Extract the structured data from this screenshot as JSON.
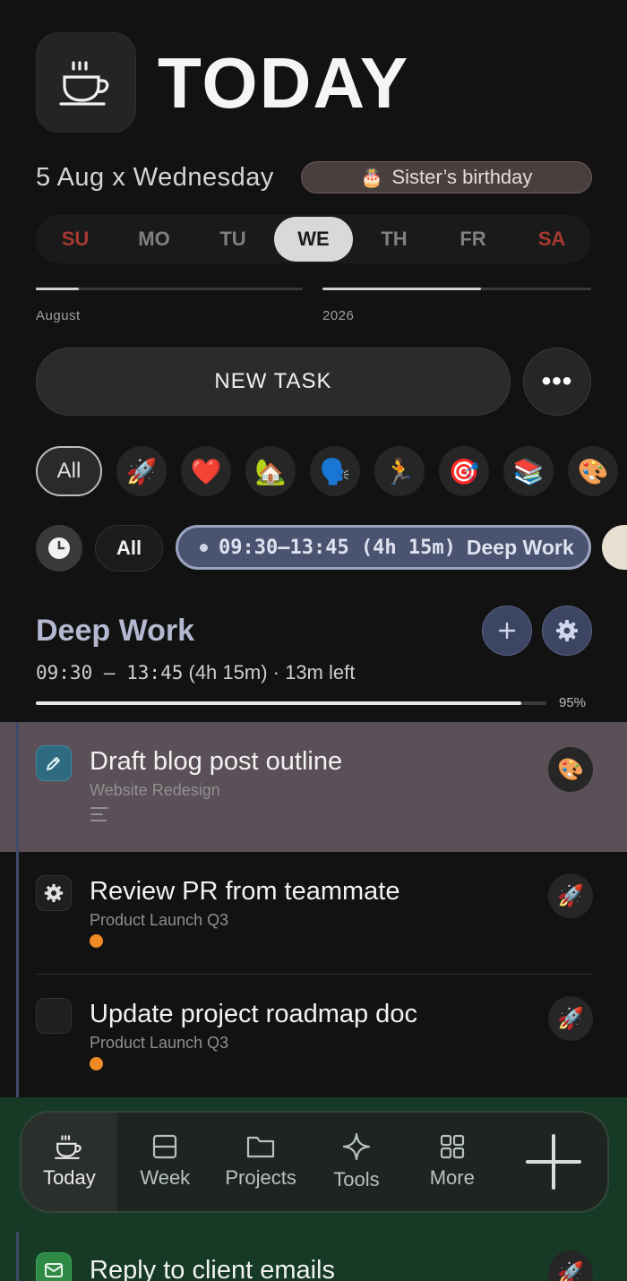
{
  "header": {
    "title": "TODAY",
    "app_icon": "coffee-cup-icon"
  },
  "date": {
    "label": "5 Aug x Wednesday"
  },
  "event": {
    "icon": "🎂",
    "label": "Sister’s birthday"
  },
  "week": {
    "days": [
      "SU",
      "MO",
      "TU",
      "WE",
      "TH",
      "FR",
      "SA"
    ],
    "active_index": 3
  },
  "progress": {
    "month": {
      "label": "August",
      "value": 0.16
    },
    "year": {
      "label": "2026",
      "value": 0.59
    }
  },
  "actions": {
    "new_task_label": "NEW TASK",
    "more_label": "•••"
  },
  "categories": {
    "all_label": "All",
    "items": [
      "🚀",
      "❤️",
      "🏡",
      "🗣️",
      "🏃",
      "🎯",
      "📚",
      "🎨"
    ]
  },
  "time_filter": {
    "all_label": "All",
    "block_time": "09:30–13:45 (4h 15m)",
    "block_name": "Deep Work"
  },
  "block": {
    "title": "Deep Work",
    "time_range": "09:30 — 13:45",
    "duration_left": "(4h 15m) · 13m left",
    "progress_label": "95%",
    "progress_value": 0.95
  },
  "tasks": [
    {
      "title": "Draft blog post outline",
      "project": "Website Redesign",
      "chip": "🎨",
      "check_icon": "pencil-icon",
      "highlighted": true
    },
    {
      "title": "Review PR from teammate",
      "project": "Product Launch Q3",
      "chip": "🚀",
      "check_icon": "gear-icon"
    },
    {
      "title": "Update project roadmap doc",
      "project": "Product Launch Q3",
      "chip": "🚀",
      "check_icon": ""
    },
    {
      "title": "Reply to client emails",
      "project": "",
      "chip": "🚀",
      "check_icon": "envelope-icon"
    }
  ],
  "nav": {
    "items": [
      {
        "label": "Today",
        "icon": "coffee-cup-icon"
      },
      {
        "label": "Week",
        "icon": "calendar-week-icon"
      },
      {
        "label": "Projects",
        "icon": "folder-icon"
      },
      {
        "label": "Tools",
        "icon": "sparkle-icon"
      },
      {
        "label": "More",
        "icon": "grid-icon"
      }
    ],
    "add_icon": "plus-icon"
  },
  "colors": {
    "background": "#121212",
    "block_accent": "#4a5470",
    "highlight_row": "#5c5058",
    "weekend": "#a63a2f",
    "priority_dot": "#f08a24",
    "nav_bg": "#173a26"
  }
}
